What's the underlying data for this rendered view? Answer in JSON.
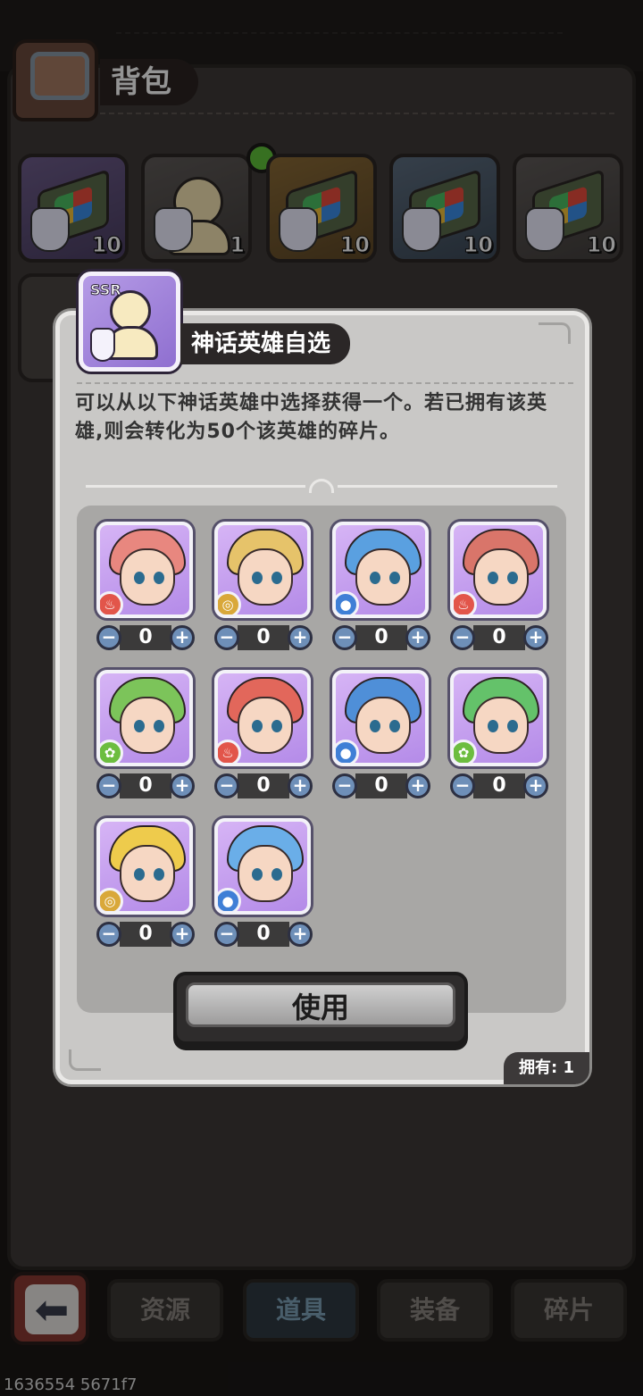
{
  "bag": {
    "title": "背包",
    "items": [
      {
        "icon": "hero-book-icon",
        "count": "10",
        "style": "purple"
      },
      {
        "icon": "ssr-hero-select-icon",
        "count": "1",
        "style": "gray"
      },
      {
        "icon": "hero-book-icon",
        "count": "10",
        "style": "gold"
      },
      {
        "icon": "hero-book-icon",
        "count": "10",
        "style": "blue"
      },
      {
        "icon": "hero-book-icon",
        "count": "10",
        "style": "gray"
      }
    ]
  },
  "tabs": [
    {
      "label": "资源",
      "active": false
    },
    {
      "label": "道具",
      "active": true
    },
    {
      "label": "装备",
      "active": false
    },
    {
      "label": "碎片",
      "active": false
    }
  ],
  "dialog": {
    "badge": "SSR",
    "title": "神话英雄自选",
    "description": "可以从以下神话英雄中选择获得一个。若已拥有该英雄,则会转化为50个该英雄的碎片。",
    "use_label": "使用",
    "owned_text": "拥有: 1",
    "heroes": [
      {
        "element": "fire",
        "qty": "0",
        "color": "#e8877f"
      },
      {
        "element": "earth",
        "qty": "0",
        "color": "#e6c36a"
      },
      {
        "element": "water",
        "qty": "0",
        "color": "#5aa0e0"
      },
      {
        "element": "fire",
        "qty": "0",
        "color": "#d9756a"
      },
      {
        "element": "wind",
        "qty": "0",
        "color": "#7cc45a"
      },
      {
        "element": "fire",
        "qty": "0",
        "color": "#e2675b"
      },
      {
        "element": "water",
        "qty": "0",
        "color": "#4f8fd8"
      },
      {
        "element": "wind",
        "qty": "0",
        "color": "#64c26a"
      },
      {
        "element": "earth",
        "qty": "0",
        "color": "#eecb4c"
      },
      {
        "element": "water",
        "qty": "0",
        "color": "#6aaee8"
      }
    ],
    "minus_label": "−",
    "plus_label": "+"
  },
  "footer_debug": "1636554 5671f7",
  "colors": {
    "accent": "#6e8fb8",
    "panel": "#c9c8c6",
    "dark": "#2b2727"
  }
}
